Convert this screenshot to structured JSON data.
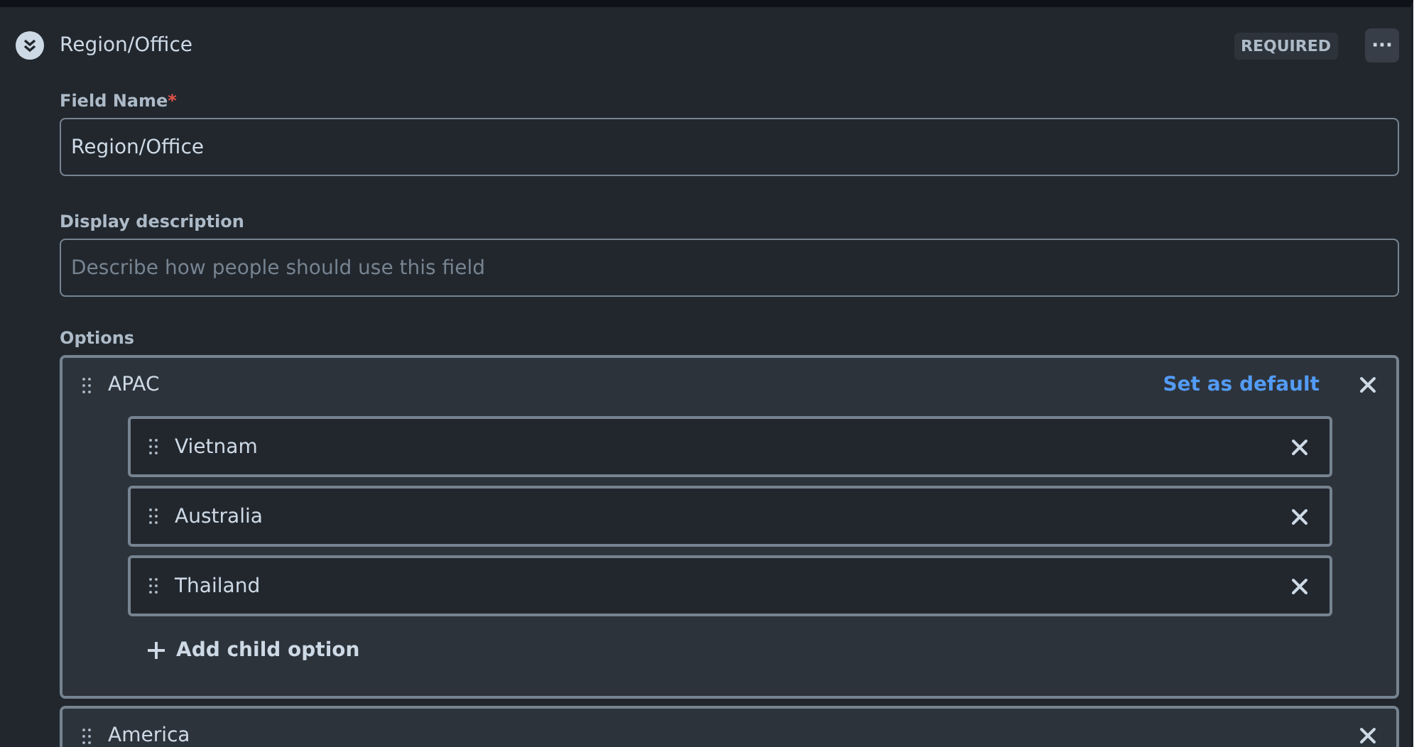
{
  "header": {
    "title": "Region/Office",
    "badge": "REQUIRED",
    "menu": "···"
  },
  "field_name": {
    "label": "Field Name",
    "required_mark": "*",
    "value": "Region/Office"
  },
  "description": {
    "label": "Display description",
    "placeholder": "Describe how people should use this field"
  },
  "options": {
    "label": "Options",
    "items": [
      {
        "label": "APAC",
        "default_link": "Set as default",
        "children": [
          {
            "label": "Vietnam"
          },
          {
            "label": "Australia"
          },
          {
            "label": "Thailand"
          }
        ],
        "add_child": "Add child option"
      },
      {
        "label": "America"
      }
    ]
  }
}
